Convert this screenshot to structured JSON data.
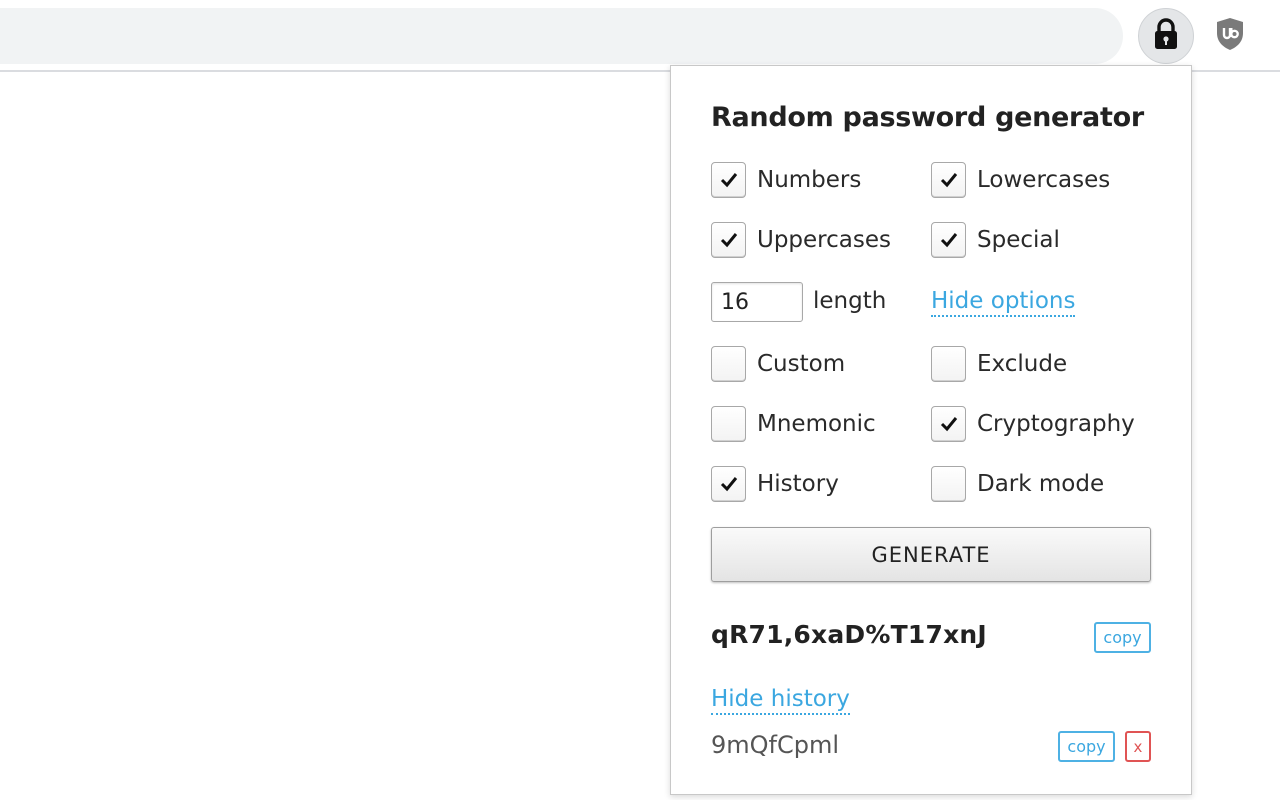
{
  "browser": {
    "extensions": [
      {
        "name": "lock-icon"
      },
      {
        "name": "ublock-shield-icon"
      }
    ]
  },
  "popup": {
    "title": "Random password generator",
    "options": {
      "numbers": {
        "label": "Numbers",
        "checked": true
      },
      "lowercases": {
        "label": "Lowercases",
        "checked": true
      },
      "uppercases": {
        "label": "Uppercases",
        "checked": true
      },
      "special": {
        "label": "Special",
        "checked": true
      },
      "custom": {
        "label": "Custom",
        "checked": false
      },
      "exclude": {
        "label": "Exclude",
        "checked": false
      },
      "mnemonic": {
        "label": "Mnemonic",
        "checked": false
      },
      "cryptography": {
        "label": "Cryptography",
        "checked": true
      },
      "history": {
        "label": "History",
        "checked": true
      },
      "dark_mode": {
        "label": "Dark mode",
        "checked": false
      }
    },
    "length": {
      "value": "16",
      "label": "length"
    },
    "hide_options_label": "Hide options",
    "generate_label": "GENERATE",
    "current_password": "qR71,6xaD%T17xnJ",
    "copy_label": "copy",
    "hide_history_label": "Hide history",
    "history": [
      {
        "password": "9mQfCpml",
        "copy_label": "copy",
        "delete_label": "x"
      }
    ]
  },
  "colors": {
    "accent": "#3ba7e0",
    "danger": "#e05454",
    "text": "#222222"
  }
}
